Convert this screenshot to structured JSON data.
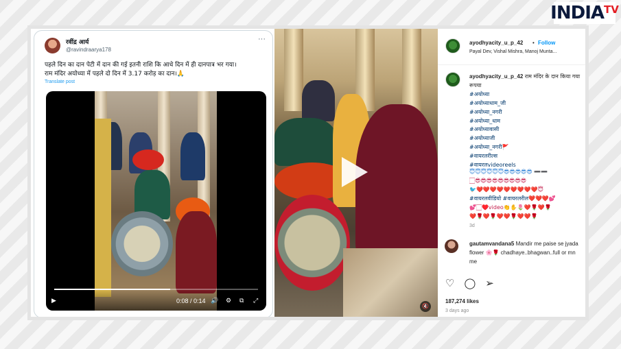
{
  "logo": {
    "main": "INDIA",
    "accent": "TV"
  },
  "tweet": {
    "author_name": "रवींद्र आर्य",
    "handle": "@ravindraarya178",
    "more": "···",
    "text_line1": "पहले दिन का दान पेटी में दान की गई इतनी राशि कि आधे दिन में ही दानपात्र भर गया।",
    "text_line2": "राम मंदिर अयोध्या में पहले दो दिन में 3.17 करोड़ का दान।🙏",
    "translate": "Translate post",
    "video": {
      "time": "0:08 / 0:14",
      "progress": 0.57
    }
  },
  "instagram": {
    "username": "ayodhyacity_u_p_42",
    "separator": "•",
    "follow": "Follow",
    "audio": "Payal Dev, Vishal Mishra, Manoj Munta...",
    "caption_user": "ayodhyacity_u_p_42",
    "caption_text": "राम मंदिर के दान किया गया रूपया",
    "hashtags": [
      "#अयोध्या",
      "#अयोध्याधाम_जी",
      "#अयोध्या_नगरी",
      "#अयोध्या_धाम",
      "#अयोध्यावासी",
      "#अयोध्याजी",
      "#अयोध्या_नगरी🚩",
      "#वायरलरील्स",
      "#वायरलvideoreels"
    ],
    "emoji_line1": "😇😇😇😇😇😇😎😎😎😎😎 ➖➖",
    "emoji_line2": "🏻😎😎😎😎😎😎😎😎😎",
    "emoji_line3": "🐦❤️❤️❤️❤️❤️❤️❤️❤️❤️😇",
    "emoji_line4": "#वायरलवीडियो #वायरलरील❤️❤️❤️💕",
    "emoji_line5": "💕🏻♥️video👏✋🌷❤️🌹❤️🌹",
    "emoji_line6": "❤️🌹❤️🌹❤️❤️🌹❤️❤️🌹",
    "age": "3d",
    "comment_user": "gautamvandana5",
    "comment_text": "Mandir me paise se jyada flower 🌸🌹 chadhaye..bhagwan..full or mn me",
    "likes": "187,274 likes",
    "ago": "3 days ago"
  },
  "colors": {
    "ig_blue": "#0095f6",
    "hashtag": "#00376b",
    "tweet_blue": "#1d9bf0",
    "logo_red": "#e31e24"
  }
}
